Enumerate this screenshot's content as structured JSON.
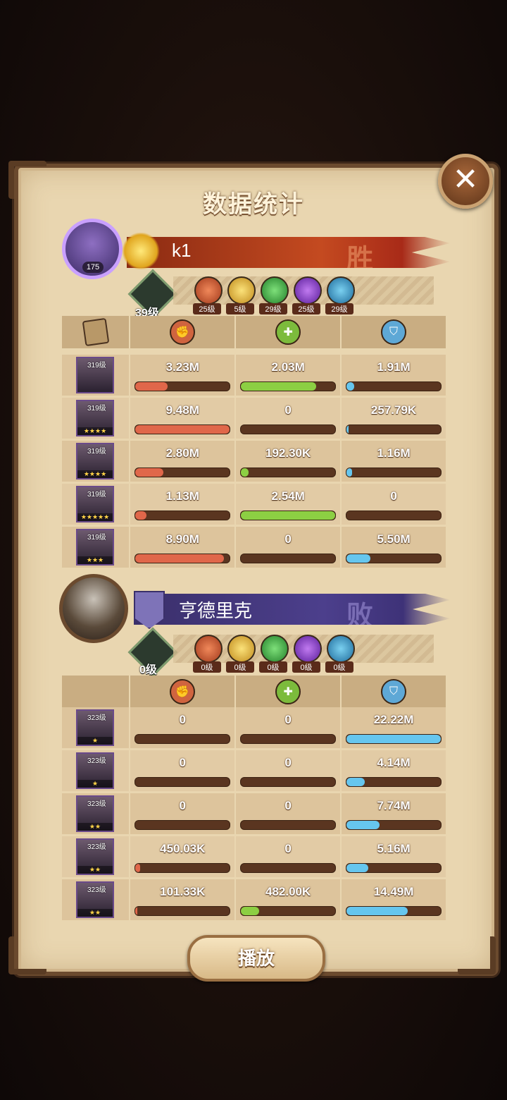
{
  "title": "数据统计",
  "close_label": "✕",
  "play_label": "播放",
  "colors": {
    "damage": "#e0674a",
    "heal": "#8ccf43",
    "shield": "#66c6ee"
  },
  "teams": [
    {
      "avatar_level": "175",
      "name": "k1",
      "result": "胜",
      "tree_level": "39级",
      "elements": [
        "25级",
        "5级",
        "29级",
        "25级",
        "29级"
      ],
      "heroes": [
        {
          "level": "319级",
          "stars": "",
          "damage": "3.23M",
          "heal": "2.03M",
          "shield": "1.91M",
          "damage_pct": 0.34,
          "heal_pct": 0.8,
          "shield_pct": 0.08
        },
        {
          "level": "319级",
          "stars": "★★★★",
          "damage": "9.48M",
          "heal": "0",
          "shield": "257.79K",
          "damage_pct": 1.0,
          "heal_pct": 0,
          "shield_pct": 0.02
        },
        {
          "level": "319级",
          "stars": "★★★★",
          "damage": "2.80M",
          "heal": "192.30K",
          "shield": "1.16M",
          "damage_pct": 0.3,
          "heal_pct": 0.08,
          "shield_pct": 0.06
        },
        {
          "level": "319级",
          "stars": "★★★★★",
          "damage": "1.13M",
          "heal": "2.54M",
          "shield": "0",
          "damage_pct": 0.12,
          "heal_pct": 1.0,
          "shield_pct": 0
        },
        {
          "level": "319级",
          "stars": "★★★",
          "damage": "8.90M",
          "heal": "0",
          "shield": "5.50M",
          "damage_pct": 0.94,
          "heal_pct": 0,
          "shield_pct": 0.25
        }
      ]
    },
    {
      "name": "亨德里克",
      "result": "败",
      "tree_level": "0级",
      "elements": [
        "0级",
        "0级",
        "0级",
        "0级",
        "0级"
      ],
      "heroes": [
        {
          "level": "323级",
          "stars": "★",
          "damage": "0",
          "heal": "0",
          "shield": "22.22M",
          "damage_pct": 0,
          "heal_pct": 0,
          "shield_pct": 1.0
        },
        {
          "level": "323级",
          "stars": "★",
          "damage": "0",
          "heal": "0",
          "shield": "4.14M",
          "damage_pct": 0,
          "heal_pct": 0,
          "shield_pct": 0.19
        },
        {
          "level": "323级",
          "stars": "★★",
          "damage": "0",
          "heal": "0",
          "shield": "7.74M",
          "damage_pct": 0,
          "heal_pct": 0,
          "shield_pct": 0.35
        },
        {
          "level": "323级",
          "stars": "★★",
          "damage": "450.03K",
          "heal": "0",
          "shield": "5.16M",
          "damage_pct": 0.05,
          "heal_pct": 0,
          "shield_pct": 0.23
        },
        {
          "level": "323级",
          "stars": "★★",
          "damage": "101.33K",
          "heal": "482.00K",
          "shield": "14.49M",
          "damage_pct": 0.02,
          "heal_pct": 0.19,
          "shield_pct": 0.65
        }
      ]
    }
  ]
}
